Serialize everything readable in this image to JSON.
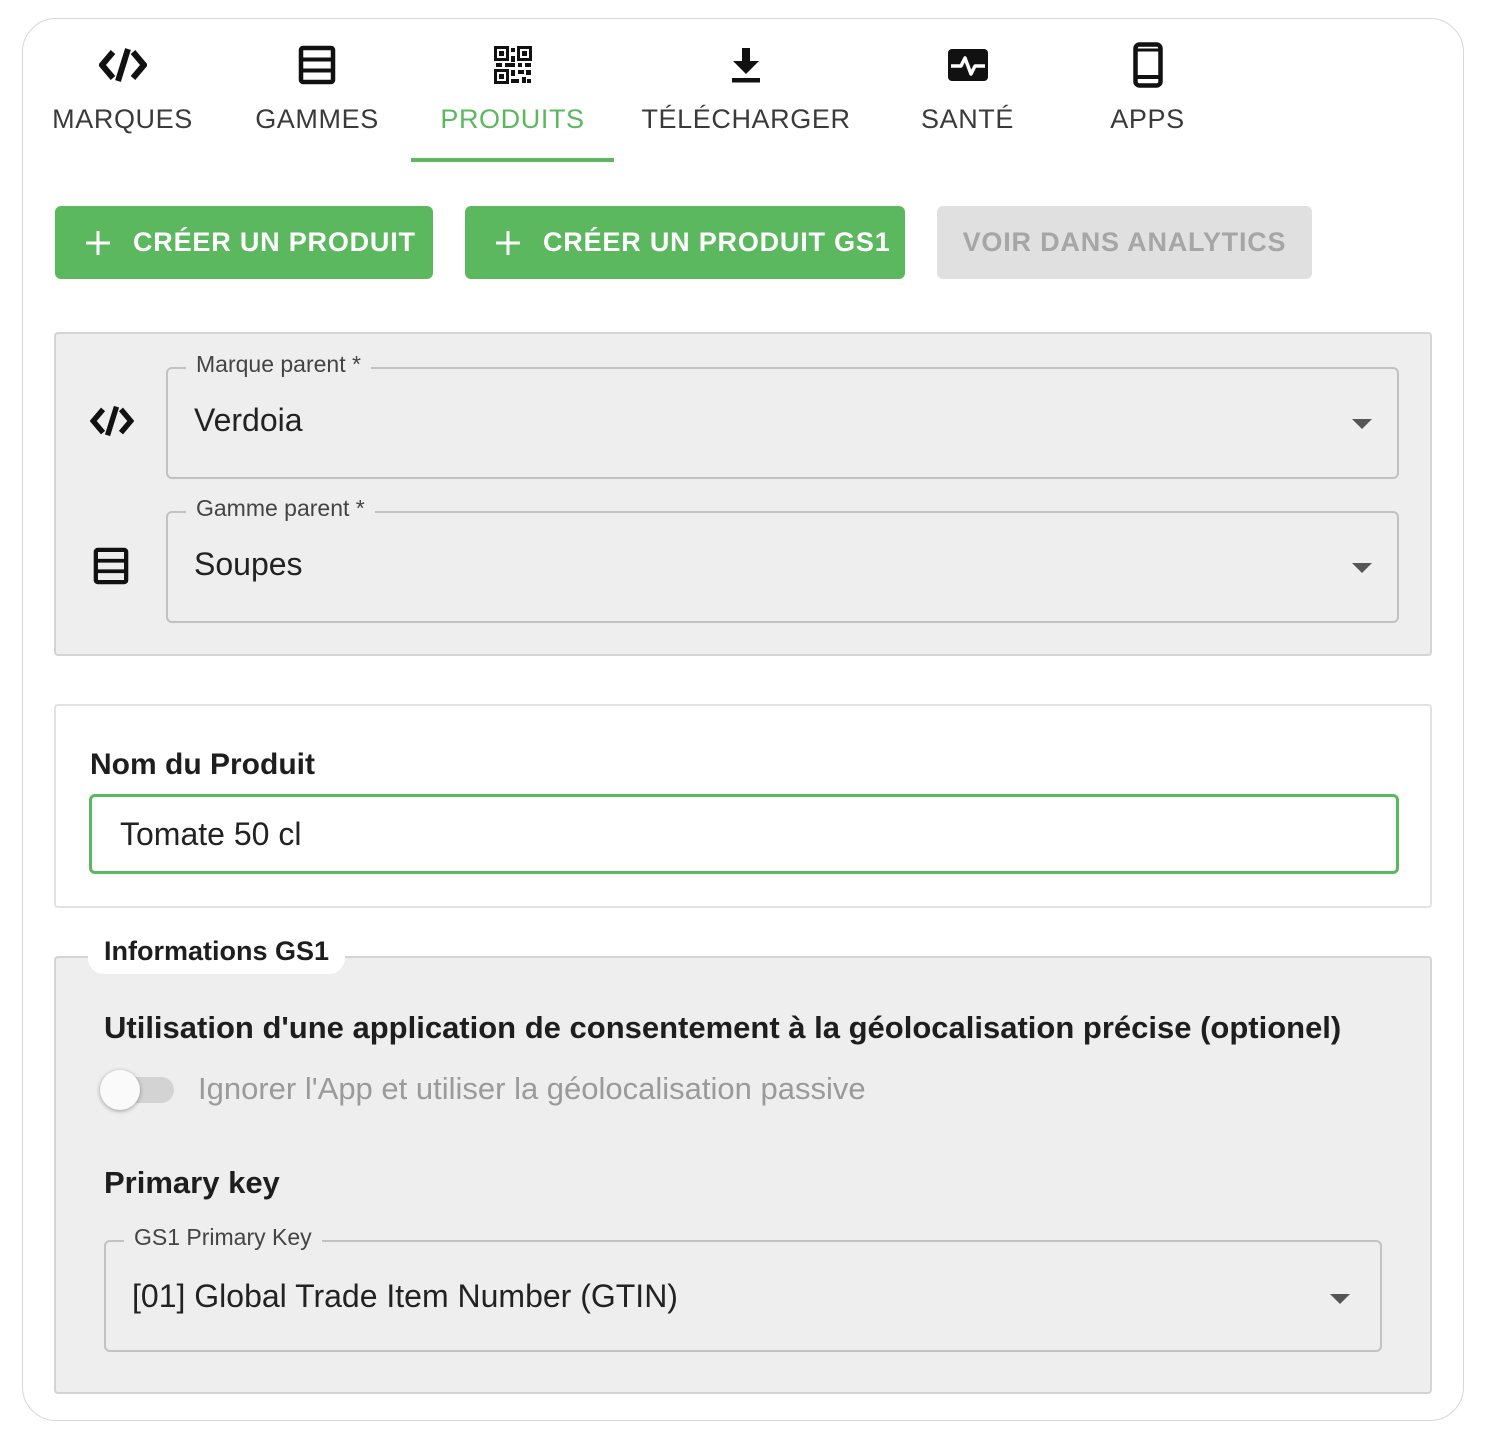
{
  "tabs": [
    {
      "label": "MARQUES",
      "icon": "code-slash-icon",
      "active": false
    },
    {
      "label": "GAMMES",
      "icon": "list-box-icon",
      "active": false
    },
    {
      "label": "PRODUITS",
      "icon": "qr-code-icon",
      "active": true
    },
    {
      "label": "TÉLÉCHARGER",
      "icon": "download-icon",
      "active": false
    },
    {
      "label": "SANTÉ",
      "icon": "health-pulse-icon",
      "active": false
    },
    {
      "label": "APPS",
      "icon": "smartphone-icon",
      "active": false
    }
  ],
  "actions": {
    "create_product": "CRÉER UN PRODUIT",
    "create_product_gs1": "CRÉER UN PRODUIT GS1",
    "view_analytics": "VOIR DANS ANALYTICS"
  },
  "parents": {
    "brand_label": "Marque parent *",
    "brand_value": "Verdoia",
    "range_label": "Gamme parent *",
    "range_value": "Soupes"
  },
  "product": {
    "name_label": "Nom du Produit",
    "name_value": "Tomate 50 cl"
  },
  "gs1": {
    "section_title": "Informations GS1",
    "geo_heading": "Utilisation d'une application de consentement à la géolocalisation précise (optionel)",
    "toggle_label": "Ignorer l'App et utiliser la géolocalisation passive",
    "toggle_on": false,
    "pk_heading": "Primary key",
    "pk_label": "GS1 Primary Key",
    "pk_value": "[01] Global Trade Item Number (GTIN)"
  },
  "colors": {
    "accent": "#5cb85f",
    "disabled_bg": "#e0e0e0",
    "panel_bg": "#eeeeee"
  }
}
